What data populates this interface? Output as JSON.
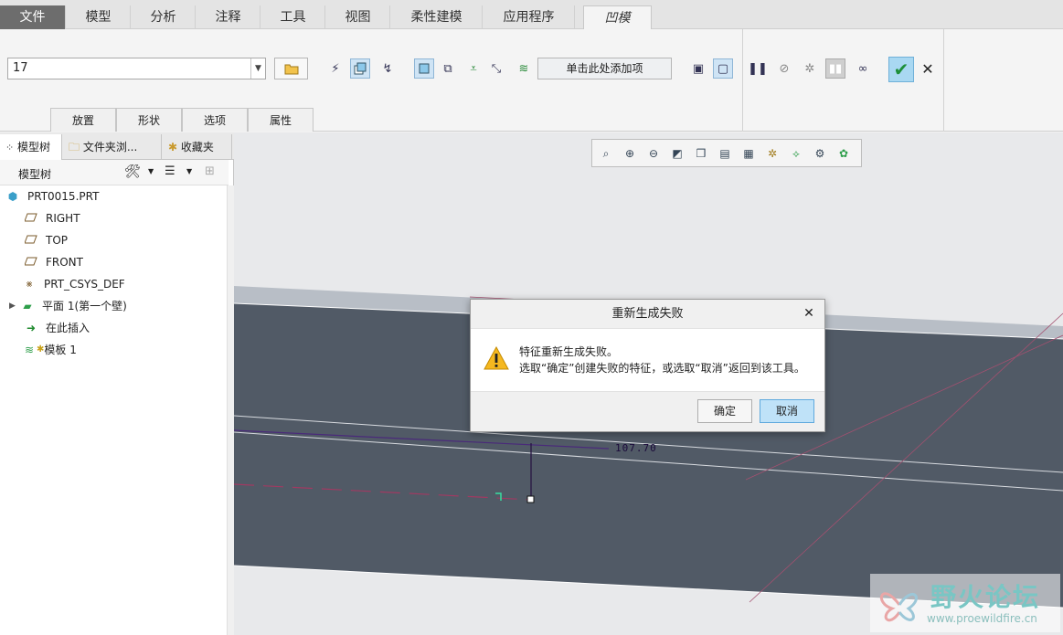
{
  "menubar": {
    "tabs": [
      {
        "label": "文件"
      },
      {
        "label": "模型"
      },
      {
        "label": "分析"
      },
      {
        "label": "注释"
      },
      {
        "label": "工具"
      },
      {
        "label": "视图"
      },
      {
        "label": "柔性建模"
      },
      {
        "label": "应用程序"
      },
      {
        "label": "凹模"
      }
    ]
  },
  "ribbon": {
    "combo_value": "17",
    "add_item_label": "单击此处添加项",
    "subtabs": [
      "放置",
      "形状",
      "选项",
      "属性"
    ]
  },
  "panel": {
    "tabs": [
      "模型树",
      "文件夹浏...",
      "收藏夹"
    ],
    "tree_header": "模型树",
    "tree": [
      {
        "label": "PRT0015.PRT",
        "icon": "part-icon"
      },
      {
        "label": "RIGHT",
        "icon": "datum-plane-icon"
      },
      {
        "label": "TOP",
        "icon": "datum-plane-icon"
      },
      {
        "label": "FRONT",
        "icon": "datum-plane-icon"
      },
      {
        "label": "PRT_CSYS_DEF",
        "icon": "csys-icon"
      },
      {
        "label": "平面 1(第一个壁)",
        "icon": "sheetmetal-wall-icon"
      },
      {
        "label": "在此插入",
        "icon": "insert-here-icon"
      },
      {
        "label": "模板 1",
        "icon": "die-form-icon"
      }
    ]
  },
  "viewport": {
    "dimension_label": "107.70"
  },
  "dialog": {
    "title": "重新生成失败",
    "message_line1": "特征重新生成失败。",
    "message_line2": "选取“确定”创建失败的特征，或选取“取消”返回到该工具。",
    "ok_label": "确定",
    "cancel_label": "取消"
  },
  "watermark": {
    "title": "野火论坛",
    "url": "www.proewildfire.cn"
  },
  "colors": {
    "model_face": "#515a66",
    "model_edge": "#ffffff",
    "accent_blue": "#a9d8f2",
    "warning_yellow": "#f5b820"
  }
}
